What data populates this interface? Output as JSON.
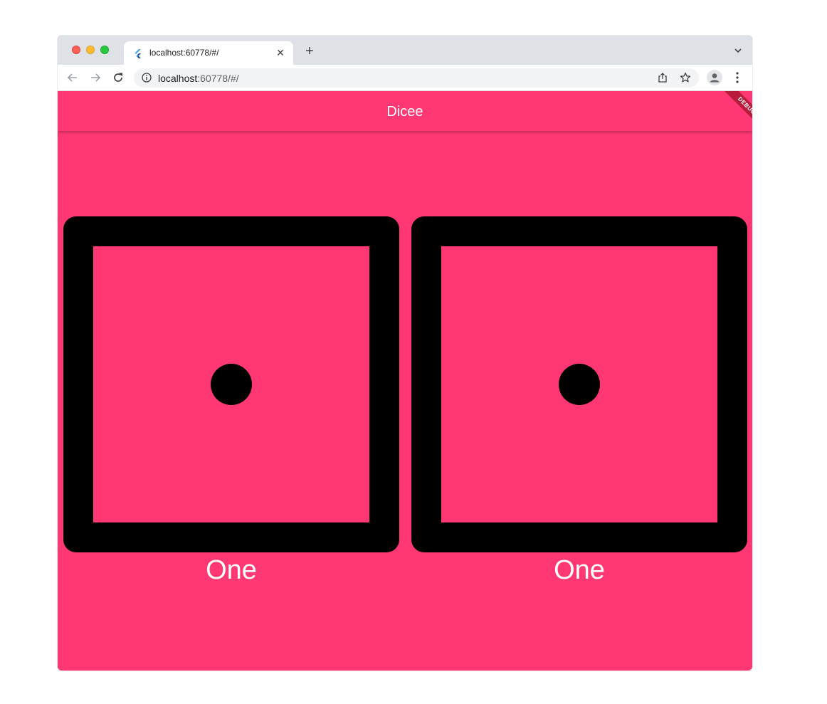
{
  "browser": {
    "tab": {
      "title": "localhost:60778/#/",
      "favicon": "flutter-icon"
    },
    "url": {
      "host": "localhost",
      "rest": ":60778/#/"
    }
  },
  "app": {
    "title": "Dicee",
    "debug_banner": "DEBUG",
    "background_color": "#ff3873",
    "dice": [
      {
        "label": "One",
        "value": 1
      },
      {
        "label": "One",
        "value": 1
      }
    ]
  }
}
